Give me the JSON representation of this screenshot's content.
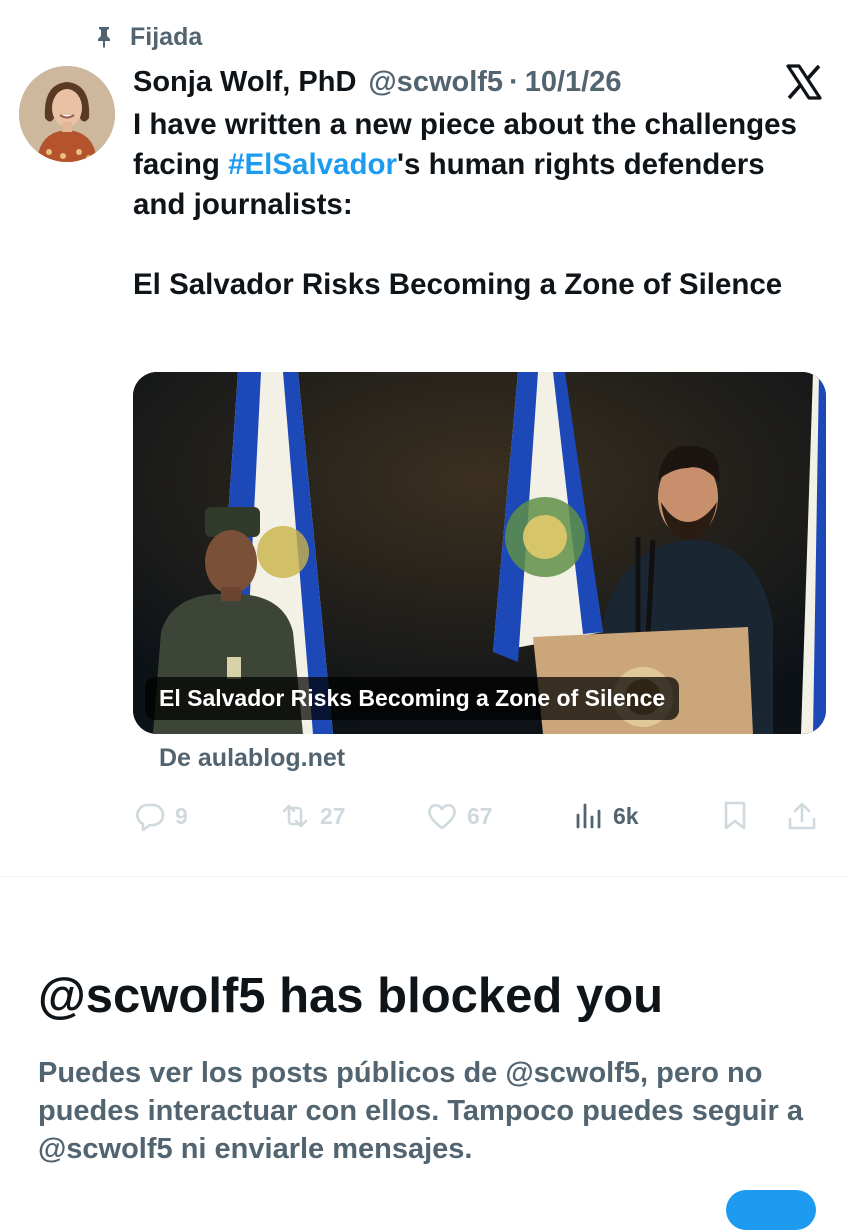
{
  "pinned": {
    "label": "Fijada",
    "icon": "pin-icon"
  },
  "author": {
    "name": "Sonja Wolf, PhD",
    "handle": "@scwolf5",
    "separator": "·",
    "date": "10/1/26"
  },
  "tweet": {
    "text_before": "I have written a new piece about the challenges facing ",
    "hashtag": "#ElSalvador",
    "text_after": "'s human rights defenders and journalists:",
    "link_title": "El Salvador Risks Becoming a Zone of Silence"
  },
  "card": {
    "caption": "El Salvador Risks Becoming a Zone of Silence",
    "source": "De aulablog.net"
  },
  "actions": {
    "replies": "9",
    "reposts": "27",
    "likes": "67",
    "views": "6k"
  },
  "blocked": {
    "title": "@scwolf5 has blocked you",
    "body": "Puedes ver los posts públicos de @scwolf5, pero no puedes interactuar con ellos. Tampoco puedes seguir a @scwolf5 ni enviarle mensajes."
  },
  "colors": {
    "accent": "#1d9bf0",
    "text": "#0f1419",
    "muted": "#536471",
    "inactive_icon": "#cfd9de"
  }
}
